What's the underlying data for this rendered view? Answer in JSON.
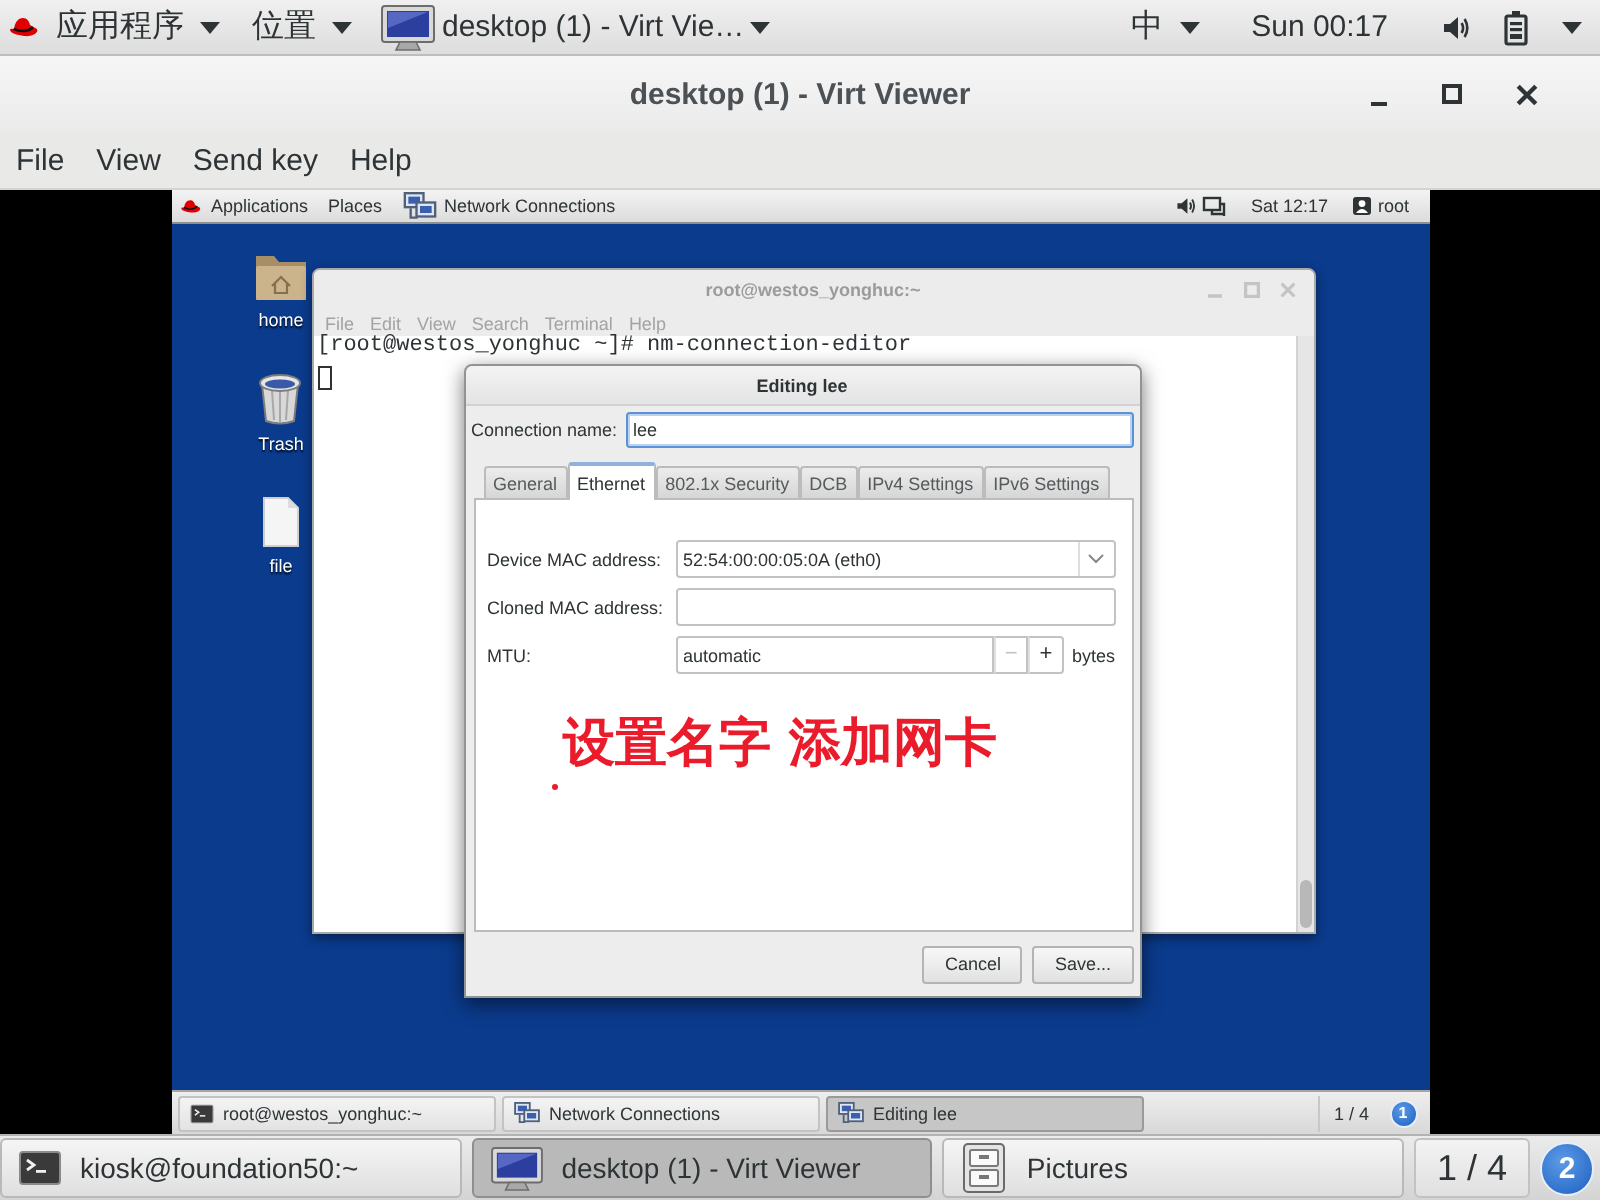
{
  "top_bar": {
    "menus": [
      "应用程序",
      "位置"
    ],
    "window_button": {
      "label": "desktop (1) - Virt Vie…"
    },
    "input_method": "中",
    "clock": "Sun 00:17"
  },
  "window": {
    "title": "desktop (1) - Virt Viewer"
  },
  "menu_bar": [
    "File",
    "View",
    "Send key",
    "Help"
  ],
  "guest": {
    "top_bar": {
      "menus": [
        "Applications",
        "Places"
      ],
      "app": "Network Connections",
      "clock": "Sat 12:17",
      "user": "root"
    },
    "desktop_icons": [
      {
        "kind": "folder",
        "label": "home"
      },
      {
        "kind": "trash",
        "label": "Trash"
      },
      {
        "kind": "file",
        "label": "file"
      }
    ],
    "terminal": {
      "title": "root@westos_yonghuc:~",
      "active": false,
      "menus": [
        "File",
        "Edit",
        "View",
        "Search",
        "Terminal",
        "Help"
      ],
      "lines": [
        "[root@westos_yonghuc ~]# nm-connection-editor"
      ]
    },
    "dialog": {
      "title": "Editing lee",
      "connection_name": {
        "label": "Connection name:",
        "value": "lee"
      },
      "tabs": [
        {
          "label": "General",
          "selected": false
        },
        {
          "label": "Ethernet",
          "selected": true
        },
        {
          "label": "802.1x Security",
          "selected": false
        },
        {
          "label": "DCB",
          "selected": false
        },
        {
          "label": "IPv4 Settings",
          "selected": false
        },
        {
          "label": "IPv6 Settings",
          "selected": false
        }
      ],
      "fields": [
        {
          "kind": "combo",
          "label": "Device MAC address:",
          "value": "52:54:00:00:05:0A (eth0)"
        },
        {
          "kind": "text",
          "label": "Cloned MAC address:"
        },
        {
          "kind": "spin",
          "label": "MTU:",
          "value": "automatic",
          "buttons": [
            {
              "label": "−",
              "disabled": true
            },
            {
              "label": "+",
              "disabled": false
            }
          ],
          "unit": "bytes"
        }
      ],
      "buttons": [
        "Cancel",
        "Save..."
      ]
    },
    "annotation": {
      "text": "设置名字 添加网卡"
    },
    "taskbar": {
      "items": [
        {
          "kind": "terminal",
          "label": "root@westos_yonghuc:~",
          "selected": false
        },
        {
          "kind": "network",
          "label": "Network Connections",
          "selected": false
        },
        {
          "kind": "network",
          "label": "Editing lee",
          "selected": true
        }
      ],
      "workspace": "1 / 4",
      "badge": "1"
    }
  },
  "taskbar": {
    "items": [
      {
        "kind": "terminal",
        "label": "kiosk@foundation50:~",
        "selected": false
      },
      {
        "kind": "monitor",
        "label": "desktop (1) - Virt Viewer",
        "selected": true
      },
      {
        "kind": "cabinet",
        "label": "Pictures",
        "selected": false
      }
    ],
    "workspace": "1 / 4",
    "badge": "2"
  }
}
